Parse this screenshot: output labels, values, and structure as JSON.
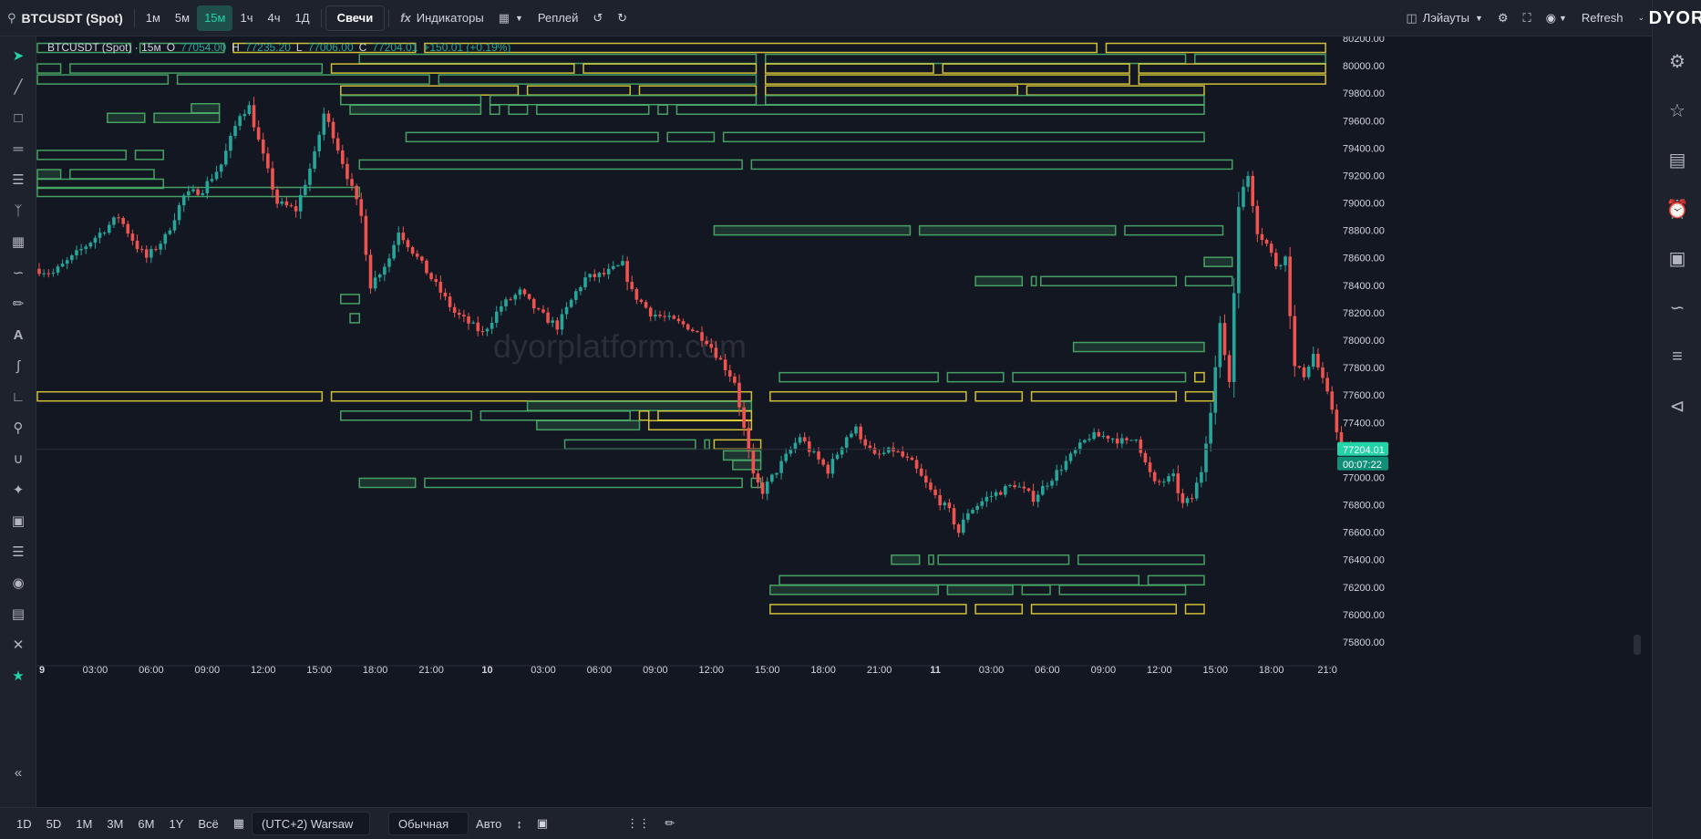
{
  "toolbar": {
    "symbol": "BTCUSDT (Spot)",
    "intervals": [
      "1м",
      "5м",
      "15м",
      "1ч",
      "4ч",
      "1Д"
    ],
    "active_interval": "15м",
    "chart_type": "Свечи",
    "indicators": "Индикаторы",
    "replay": "Реплей",
    "layouts": "Лэйауты",
    "refresh": "Refresh"
  },
  "legend": {
    "title": "BTCUSDT (Spot) · 15м",
    "o_label": "O",
    "o": "77054.00",
    "h_label": "H",
    "h": "77235.20",
    "l_label": "L",
    "l": "77006.00",
    "c_label": "C",
    "c": "77204.01",
    "change": "+150.01 (+0.19%)"
  },
  "watermark": "dyorplatform.com",
  "logo": "DYOR",
  "bottom": {
    "ranges": [
      "1D",
      "5D",
      "1M",
      "3M",
      "6M",
      "1Y",
      "Всё"
    ],
    "timezone": "(UTC+2) Warsaw",
    "scale_mode": "Обычная",
    "auto": "Авто"
  },
  "colors": {
    "up": "#26a69a",
    "down": "#ef5350",
    "zone_green": "#4caf6a",
    "zone_yellow": "#e3d23a",
    "accent": "#22d3a8"
  },
  "chart_data": {
    "type": "candlestick",
    "title": "",
    "xlabel": "",
    "ylabel": "",
    "ylim": [
      75750,
      80250
    ],
    "y_ticks": [
      80200,
      80000,
      79800,
      79600,
      79400,
      79200,
      79000,
      78800,
      78600,
      78400,
      78200,
      78000,
      77800,
      77600,
      77400,
      77200,
      77000,
      76800,
      76600,
      76400,
      76200,
      76000,
      75800
    ],
    "y_tick_labels": [
      "80200.00",
      "80000.00",
      "79800.00",
      "79600.00",
      "79400.00",
      "79200.00",
      "79000.00",
      "78800.00",
      "78600.00",
      "78400.00",
      "78200.00",
      "78000.00",
      "77800.00",
      "77600.00",
      "77400.00",
      "77200.00",
      "77000.00",
      "76800.00",
      "76600.00",
      "76400.00",
      "76200.00",
      "76000.00",
      "75800.00"
    ],
    "x_ticks": [
      {
        "label": "9",
        "bar": 0,
        "bold": true
      },
      {
        "label": "03:00",
        "bar": 12
      },
      {
        "label": "06:00",
        "bar": 24
      },
      {
        "label": "09:00",
        "bar": 36
      },
      {
        "label": "12:00",
        "bar": 48
      },
      {
        "label": "15:00",
        "bar": 60
      },
      {
        "label": "18:00",
        "bar": 72
      },
      {
        "label": "21:00",
        "bar": 84
      },
      {
        "label": "10",
        "bar": 96,
        "bold": true
      },
      {
        "label": "03:00",
        "bar": 108
      },
      {
        "label": "06:00",
        "bar": 120
      },
      {
        "label": "09:00",
        "bar": 132
      },
      {
        "label": "12:00",
        "bar": 144
      },
      {
        "label": "15:00",
        "bar": 156
      },
      {
        "label": "18:00",
        "bar": 168
      },
      {
        "label": "21:00",
        "bar": 180
      },
      {
        "label": "11",
        "bar": 192,
        "bold": true
      },
      {
        "label": "03:00",
        "bar": 204
      },
      {
        "label": "06:00",
        "bar": 216
      },
      {
        "label": "09:00",
        "bar": 228
      },
      {
        "label": "12:00",
        "bar": 240
      },
      {
        "label": "15:00",
        "bar": 252
      },
      {
        "label": "18:00",
        "bar": 264
      },
      {
        "label": "21:0",
        "bar": 276
      }
    ],
    "price_label": "77204.01",
    "price_value": 77204.01,
    "countdown": "00:07:22",
    "waypoints": [
      [
        0,
        78520
      ],
      [
        4,
        78490
      ],
      [
        8,
        78600
      ],
      [
        14,
        78780
      ],
      [
        18,
        78900
      ],
      [
        22,
        78680
      ],
      [
        24,
        78600
      ],
      [
        28,
        78750
      ],
      [
        32,
        79050
      ],
      [
        36,
        79100
      ],
      [
        40,
        79280
      ],
      [
        44,
        79650
      ],
      [
        46,
        79700
      ],
      [
        48,
        79450
      ],
      [
        52,
        79000
      ],
      [
        56,
        78950
      ],
      [
        60,
        79350
      ],
      [
        62,
        79650
      ],
      [
        64,
        79500
      ],
      [
        68,
        79100
      ],
      [
        70,
        78900
      ],
      [
        72,
        78400
      ],
      [
        76,
        78600
      ],
      [
        78,
        78800
      ],
      [
        80,
        78700
      ],
      [
        84,
        78500
      ],
      [
        88,
        78300
      ],
      [
        90,
        78200
      ],
      [
        94,
        78100
      ],
      [
        96,
        78050
      ],
      [
        100,
        78250
      ],
      [
        104,
        78350
      ],
      [
        108,
        78200
      ],
      [
        112,
        78100
      ],
      [
        116,
        78350
      ],
      [
        118,
        78450
      ],
      [
        122,
        78480
      ],
      [
        126,
        78550
      ],
      [
        128,
        78350
      ],
      [
        132,
        78200
      ],
      [
        136,
        78150
      ],
      [
        140,
        78100
      ],
      [
        144,
        78000
      ],
      [
        150,
        77700
      ],
      [
        154,
        77000
      ],
      [
        156,
        76900
      ],
      [
        160,
        77100
      ],
      [
        164,
        77300
      ],
      [
        166,
        77200
      ],
      [
        170,
        77050
      ],
      [
        174,
        77300
      ],
      [
        176,
        77350
      ],
      [
        180,
        77150
      ],
      [
        184,
        77200
      ],
      [
        188,
        77100
      ],
      [
        192,
        76900
      ],
      [
        196,
        76750
      ],
      [
        198,
        76600
      ],
      [
        200,
        76750
      ],
      [
        204,
        76850
      ],
      [
        210,
        76950
      ],
      [
        214,
        76850
      ],
      [
        218,
        77000
      ],
      [
        222,
        77150
      ],
      [
        226,
        77300
      ],
      [
        230,
        77300
      ],
      [
        234,
        77250
      ],
      [
        236,
        77300
      ],
      [
        238,
        77100
      ],
      [
        240,
        76950
      ],
      [
        244,
        77000
      ],
      [
        246,
        76800
      ],
      [
        248,
        76850
      ],
      [
        250,
        77050
      ],
      [
        252,
        77500
      ],
      [
        254,
        78100
      ],
      [
        256,
        77700
      ],
      [
        258,
        79000
      ],
      [
        260,
        79200
      ],
      [
        262,
        78800
      ],
      [
        264,
        78700
      ],
      [
        266,
        78550
      ],
      [
        268,
        78600
      ],
      [
        270,
        77800
      ],
      [
        272,
        77750
      ],
      [
        274,
        77900
      ],
      [
        276,
        77700
      ],
      [
        278,
        77500
      ],
      [
        280,
        77200
      ],
      [
        284,
        77200
      ]
    ],
    "bar_count": 285,
    "zones": [
      {
        "x0": 0,
        "x1": 20,
        "y": 80130,
        "c": "g"
      },
      {
        "x0": 22,
        "x1": 40,
        "y": 80130,
        "c": "g"
      },
      {
        "x0": 42,
        "x1": 81,
        "y": 80130,
        "c": "y"
      },
      {
        "x0": 83,
        "x1": 227,
        "y": 80130,
        "c": "y"
      },
      {
        "x0": 229,
        "x1": 276,
        "y": 80130,
        "c": "y"
      },
      {
        "x0": 69,
        "x1": 154,
        "y": 80050,
        "c": "g"
      },
      {
        "x0": 156,
        "x1": 246,
        "y": 80050,
        "c": "g"
      },
      {
        "x0": 248,
        "x1": 276,
        "y": 80050,
        "c": "g"
      },
      {
        "x0": 0,
        "x1": 5,
        "y": 79980,
        "c": "g"
      },
      {
        "x0": 7,
        "x1": 61,
        "y": 79980,
        "c": "g"
      },
      {
        "x0": 63,
        "x1": 115,
        "y": 79980,
        "c": "y"
      },
      {
        "x0": 117,
        "x1": 154,
        "y": 79980,
        "c": "y"
      },
      {
        "x0": 156,
        "x1": 192,
        "y": 79980,
        "c": "y"
      },
      {
        "x0": 194,
        "x1": 234,
        "y": 79980,
        "c": "y"
      },
      {
        "x0": 236,
        "x1": 276,
        "y": 79980,
        "c": "y"
      },
      {
        "x0": 0,
        "x1": 28,
        "y": 79900,
        "c": "g"
      },
      {
        "x0": 30,
        "x1": 84,
        "y": 79900,
        "c": "g"
      },
      {
        "x0": 86,
        "x1": 154,
        "y": 79900,
        "c": "g"
      },
      {
        "x0": 156,
        "x1": 234,
        "y": 79900,
        "c": "y"
      },
      {
        "x0": 236,
        "x1": 276,
        "y": 79900,
        "c": "y"
      },
      {
        "x0": 65,
        "x1": 103,
        "y": 79820,
        "c": "y"
      },
      {
        "x0": 105,
        "x1": 127,
        "y": 79820,
        "c": "y"
      },
      {
        "x0": 129,
        "x1": 154,
        "y": 79820,
        "c": "y"
      },
      {
        "x0": 156,
        "x1": 210,
        "y": 79820,
        "c": "y"
      },
      {
        "x0": 212,
        "x1": 250,
        "y": 79820,
        "c": "y"
      },
      {
        "x0": 65,
        "x1": 95,
        "y": 79750,
        "c": "g"
      },
      {
        "x0": 97,
        "x1": 154,
        "y": 79750,
        "c": "g"
      },
      {
        "x0": 156,
        "x1": 250,
        "y": 79750,
        "c": "g"
      },
      {
        "x0": 67,
        "x1": 95,
        "y": 79680,
        "c": "g",
        "f": 1
      },
      {
        "x0": 97,
        "x1": 99,
        "y": 79680,
        "c": "g"
      },
      {
        "x0": 101,
        "x1": 105,
        "y": 79680,
        "c": "g"
      },
      {
        "x0": 107,
        "x1": 131,
        "y": 79680,
        "c": "g"
      },
      {
        "x0": 133,
        "x1": 135,
        "y": 79680,
        "c": "g"
      },
      {
        "x0": 137,
        "x1": 250,
        "y": 79680,
        "c": "g"
      },
      {
        "x0": 15,
        "x1": 23,
        "y": 79620,
        "c": "g",
        "f": 1
      },
      {
        "x0": 25,
        "x1": 39,
        "y": 79620,
        "c": "g",
        "f": 1
      },
      {
        "x0": 33,
        "x1": 39,
        "y": 79690,
        "c": "g",
        "f": 1
      },
      {
        "x0": 79,
        "x1": 133,
        "y": 79480,
        "c": "g"
      },
      {
        "x0": 135,
        "x1": 145,
        "y": 79480,
        "c": "g"
      },
      {
        "x0": 147,
        "x1": 250,
        "y": 79480,
        "c": "g"
      },
      {
        "x0": 0,
        "x1": 19,
        "y": 79350,
        "c": "g"
      },
      {
        "x0": 21,
        "x1": 27,
        "y": 79350,
        "c": "g"
      },
      {
        "x0": 69,
        "x1": 151,
        "y": 79280,
        "c": "g"
      },
      {
        "x0": 153,
        "x1": 256,
        "y": 79280,
        "c": "g"
      },
      {
        "x0": 0,
        "x1": 5,
        "y": 79210,
        "c": "g",
        "f": 1
      },
      {
        "x0": 7,
        "x1": 25,
        "y": 79210,
        "c": "g"
      },
      {
        "x0": 0,
        "x1": 27,
        "y": 79140,
        "c": "g"
      },
      {
        "x0": 0,
        "x1": 69,
        "y": 79080,
        "c": "g"
      },
      {
        "x0": 145,
        "x1": 187,
        "y": 78800,
        "c": "g",
        "f": 1
      },
      {
        "x0": 189,
        "x1": 231,
        "y": 78800,
        "c": "g",
        "f": 1
      },
      {
        "x0": 233,
        "x1": 254,
        "y": 78800,
        "c": "g"
      },
      {
        "x0": 250,
        "x1": 256,
        "y": 78570,
        "c": "g",
        "f": 1
      },
      {
        "x0": 201,
        "x1": 211,
        "y": 78430,
        "c": "g",
        "f": 1
      },
      {
        "x0": 213,
        "x1": 214,
        "y": 78430,
        "c": "g"
      },
      {
        "x0": 215,
        "x1": 244,
        "y": 78430,
        "c": "g"
      },
      {
        "x0": 246,
        "x1": 256,
        "y": 78430,
        "c": "g"
      },
      {
        "x0": 65,
        "x1": 69,
        "y": 78300,
        "c": "g"
      },
      {
        "x0": 67,
        "x1": 69,
        "y": 78160,
        "c": "g"
      },
      {
        "x0": 222,
        "x1": 250,
        "y": 77950,
        "c": "g",
        "f": 1
      },
      {
        "x0": 159,
        "x1": 193,
        "y": 77730,
        "c": "g"
      },
      {
        "x0": 195,
        "x1": 207,
        "y": 77730,
        "c": "g"
      },
      {
        "x0": 209,
        "x1": 246,
        "y": 77730,
        "c": "g"
      },
      {
        "x0": 248,
        "x1": 250,
        "y": 77730,
        "c": "y"
      },
      {
        "x0": 0,
        "x1": 61,
        "y": 77590,
        "c": "y"
      },
      {
        "x0": 63,
        "x1": 153,
        "y": 77590,
        "c": "y"
      },
      {
        "x0": 157,
        "x1": 199,
        "y": 77590,
        "c": "y"
      },
      {
        "x0": 201,
        "x1": 211,
        "y": 77590,
        "c": "y"
      },
      {
        "x0": 213,
        "x1": 244,
        "y": 77590,
        "c": "y"
      },
      {
        "x0": 246,
        "x1": 252,
        "y": 77590,
        "c": "y"
      },
      {
        "x0": 105,
        "x1": 153,
        "y": 77520,
        "c": "g",
        "f": 1
      },
      {
        "x0": 65,
        "x1": 93,
        "y": 77450,
        "c": "g"
      },
      {
        "x0": 95,
        "x1": 127,
        "y": 77450,
        "c": "g"
      },
      {
        "x0": 129,
        "x1": 131,
        "y": 77450,
        "c": "y"
      },
      {
        "x0": 133,
        "x1": 153,
        "y": 77450,
        "c": "y"
      },
      {
        "x0": 107,
        "x1": 129,
        "y": 77380,
        "c": "g",
        "f": 1
      },
      {
        "x0": 131,
        "x1": 153,
        "y": 77380,
        "c": "y"
      },
      {
        "x0": 113,
        "x1": 141,
        "y": 77240,
        "c": "g"
      },
      {
        "x0": 143,
        "x1": 144,
        "y": 77240,
        "c": "g"
      },
      {
        "x0": 145,
        "x1": 155,
        "y": 77240,
        "c": "y"
      },
      {
        "x0": 147,
        "x1": 155,
        "y": 77160,
        "c": "g",
        "f": 1
      },
      {
        "x0": 149,
        "x1": 155,
        "y": 77090,
        "c": "g",
        "f": 1
      },
      {
        "x0": 69,
        "x1": 81,
        "y": 76960,
        "c": "g",
        "f": 1
      },
      {
        "x0": 83,
        "x1": 151,
        "y": 76960,
        "c": "g"
      },
      {
        "x0": 153,
        "x1": 155,
        "y": 76960,
        "c": "g"
      },
      {
        "x0": 183,
        "x1": 189,
        "y": 76400,
        "c": "g",
        "f": 1
      },
      {
        "x0": 191,
        "x1": 192,
        "y": 76400,
        "c": "g"
      },
      {
        "x0": 193,
        "x1": 221,
        "y": 76400,
        "c": "g"
      },
      {
        "x0": 223,
        "x1": 250,
        "y": 76400,
        "c": "g"
      },
      {
        "x0": 159,
        "x1": 236,
        "y": 76250,
        "c": "g"
      },
      {
        "x0": 238,
        "x1": 250,
        "y": 76250,
        "c": "g"
      },
      {
        "x0": 157,
        "x1": 193,
        "y": 76180,
        "c": "g",
        "f": 1
      },
      {
        "x0": 195,
        "x1": 209,
        "y": 76180,
        "c": "g",
        "f": 1
      },
      {
        "x0": 211,
        "x1": 217,
        "y": 76180,
        "c": "g"
      },
      {
        "x0": 219,
        "x1": 246,
        "y": 76180,
        "c": "g"
      },
      {
        "x0": 157,
        "x1": 199,
        "y": 76040,
        "c": "y"
      },
      {
        "x0": 201,
        "x1": 211,
        "y": 76040,
        "c": "y"
      },
      {
        "x0": 213,
        "x1": 244,
        "y": 76040,
        "c": "y"
      },
      {
        "x0": 246,
        "x1": 250,
        "y": 76040,
        "c": "y"
      }
    ]
  }
}
